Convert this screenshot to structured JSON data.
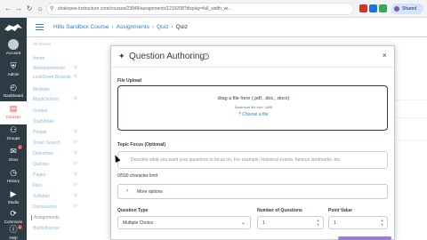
{
  "browser": {
    "url": "shakopee.instructure.com/courses/23848/assignments/1219208?display=full_width_wi...",
    "profile_label": "Shared",
    "colors": {
      "ext1": "#d93025",
      "ext2": "#1a73e8",
      "ext3": "#34a853",
      "ext4": "#fbbc04",
      "ext5": "#7b5ea7"
    }
  },
  "global_nav": {
    "items": [
      {
        "label": "Account",
        "icon": "avatar-icon"
      },
      {
        "label": "Admin",
        "icon": "shield-icon"
      },
      {
        "label": "Dashboard",
        "icon": "dashboard-icon"
      },
      {
        "label": "Courses",
        "icon": "book-icon"
      },
      {
        "label": "Groups",
        "icon": "groups-icon"
      },
      {
        "label": "Inbox",
        "icon": "inbox-icon",
        "badge": "1"
      },
      {
        "label": "History",
        "icon": "clock-icon"
      },
      {
        "label": "Studio",
        "icon": "studio-icon"
      },
      {
        "label": "Commons",
        "icon": "commons-icon"
      },
      {
        "label": "Help",
        "icon": "help-icon",
        "badge": "1"
      }
    ],
    "accent": "#e4483b",
    "bg": "#2d3b45"
  },
  "breadcrumb": {
    "course": "Hills Sandbox Course",
    "section": "Assignments",
    "item": "Quiz",
    "current": "Quiz"
  },
  "course_nav": {
    "subtitle": "All Scores",
    "items": [
      {
        "label": "Home",
        "eye": false
      },
      {
        "label": "Announcements",
        "eye": true
      },
      {
        "label": "LockDown Browser",
        "eye": true
      },
      {
        "label": "Modules",
        "eye": false
      },
      {
        "label": "MagicSchool",
        "eye": true
      },
      {
        "label": "Grades",
        "eye": false
      },
      {
        "label": "StudyMate",
        "eye": false
      },
      {
        "label": "People",
        "eye": true
      },
      {
        "label": "Smart Search",
        "eye": true
      },
      {
        "label": "Outcomes",
        "eye": true
      },
      {
        "label": "Quizzes",
        "eye": true
      },
      {
        "label": "Pages",
        "eye": true
      },
      {
        "label": "Files",
        "eye": true
      },
      {
        "label": "Syllabus",
        "eye": true
      },
      {
        "label": "Discussions",
        "eye": true
      },
      {
        "label": "Assignments",
        "eye": false,
        "active": true
      },
      {
        "label": "BuiltInfluence",
        "eye": false
      }
    ]
  },
  "modal": {
    "title": "Question Authoring",
    "help": "?",
    "close": "×",
    "file_upload": {
      "label": "File Upload",
      "main": "drag a file here (.pdf, .doc, .docx)",
      "sub": "Maximum file size: 1MB",
      "link": "Choose a file"
    },
    "topic": {
      "label": "Topic Focus (Optional)",
      "placeholder": "Describe what you want your questions to focus on. For example: historical events, famous landmarks, etc.",
      "char_limit": "0/500 character limit"
    },
    "more_options": "More options",
    "question_type": {
      "label": "Question Type",
      "value": "Multiple Choice"
    },
    "num_questions": {
      "label": "Number of Questions",
      "value": "1"
    },
    "point_value": {
      "label": "Point Value",
      "value": "1"
    }
  }
}
